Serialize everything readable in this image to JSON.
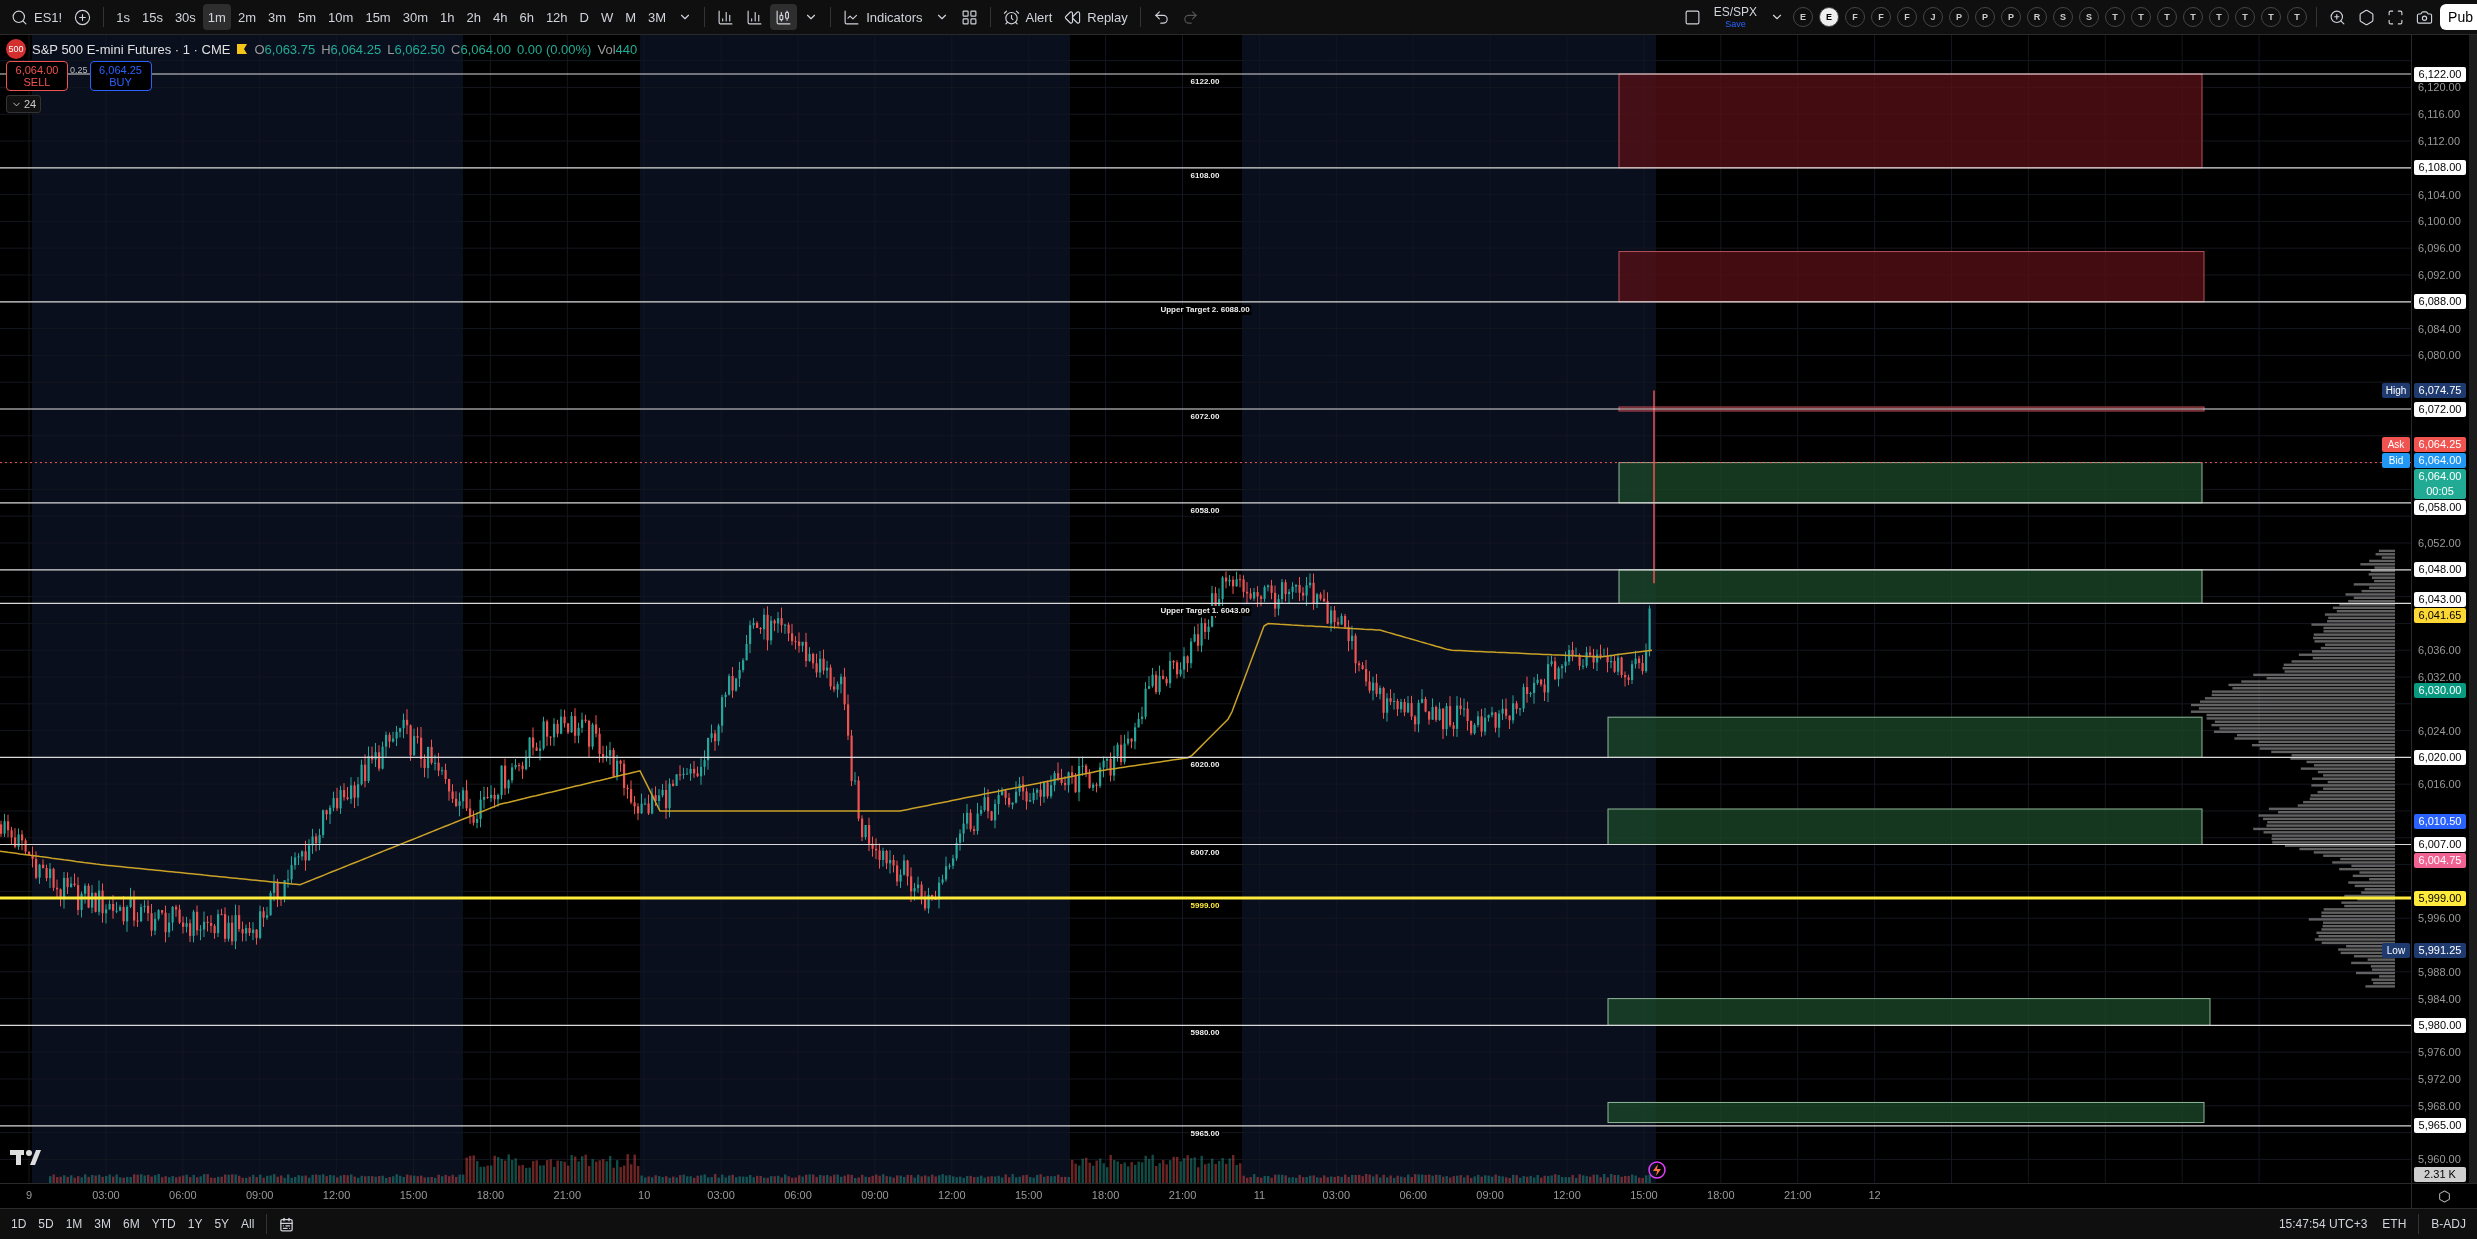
{
  "toolbar": {
    "symbol": "ES1!",
    "intervals": [
      {
        "label": "1s",
        "selected": false
      },
      {
        "label": "15s",
        "selected": false
      },
      {
        "label": "30s",
        "selected": false
      },
      {
        "label": "1m",
        "selected": true
      },
      {
        "label": "2m",
        "selected": false
      },
      {
        "label": "3m",
        "selected": false
      },
      {
        "label": "5m",
        "selected": false
      },
      {
        "label": "10m",
        "selected": false
      },
      {
        "label": "15m",
        "selected": false
      },
      {
        "label": "30m",
        "selected": false
      },
      {
        "label": "1h",
        "selected": false
      },
      {
        "label": "2h",
        "selected": false
      },
      {
        "label": "4h",
        "selected": false
      },
      {
        "label": "6h",
        "selected": false
      },
      {
        "label": "12h",
        "selected": false
      },
      {
        "label": "D",
        "selected": false
      },
      {
        "label": "W",
        "selected": false
      },
      {
        "label": "M",
        "selected": false
      },
      {
        "label": "3M",
        "selected": false
      }
    ],
    "indicators": "Indicators",
    "alert": "Alert",
    "replay": "Replay",
    "undo": {
      "disabled": false
    },
    "redo": {
      "disabled": true
    },
    "layout_name": "ES/SPX",
    "layout_save": "Save",
    "letters": [
      {
        "label": "E",
        "selected": false
      },
      {
        "label": "E",
        "selected": true
      },
      {
        "label": "F",
        "selected": false
      },
      {
        "label": "F",
        "selected": false
      },
      {
        "label": "F",
        "selected": false
      },
      {
        "label": "J",
        "selected": false
      },
      {
        "label": "P",
        "selected": false
      },
      {
        "label": "P",
        "selected": false
      },
      {
        "label": "P",
        "selected": false
      },
      {
        "label": "R",
        "selected": false
      },
      {
        "label": "S",
        "selected": false
      },
      {
        "label": "S",
        "selected": false
      },
      {
        "label": "T",
        "selected": false
      },
      {
        "label": "T",
        "selected": false
      },
      {
        "label": "T",
        "selected": false
      },
      {
        "label": "T",
        "selected": false
      },
      {
        "label": "T",
        "selected": false
      },
      {
        "label": "T",
        "selected": false
      },
      {
        "label": "T",
        "selected": false
      },
      {
        "label": "T",
        "selected": false
      }
    ],
    "publish": "Pub"
  },
  "legend": {
    "badge": "500",
    "title": "S&P 500 E-mini Futures · 1 · CME",
    "ohlc": [
      {
        "key": "O",
        "value": "6,063.75"
      },
      {
        "key": "H",
        "value": "6,064.25"
      },
      {
        "key": "L",
        "value": "6,062.50"
      },
      {
        "key": "C",
        "value": "6,064.00"
      }
    ],
    "change": "0.00 (0.00%)",
    "volume_key": "Vol",
    "volume": "440"
  },
  "trade": {
    "sell_price": "6,064.00",
    "sell_label": "SELL",
    "spread": "0.25",
    "buy_price": "6,064.25",
    "buy_label": "BUY"
  },
  "collapse": {
    "count": "24"
  },
  "levels": [
    {
      "label": "6122.00",
      "axis": "6,122.00",
      "kind": "line"
    },
    {
      "label": "6108.00",
      "axis": "6,108.00",
      "kind": "line"
    },
    {
      "label": "Upper Target 2. 6088.00",
      "axis": "6,088.00",
      "kind": "line"
    },
    {
      "label": "6072.00",
      "axis": "6,072.00",
      "kind": "line"
    },
    {
      "label": "6058.00",
      "axis": "6,058.00",
      "kind": "line"
    },
    {
      "axis": "6,048.00",
      "kind": "line"
    },
    {
      "label": "Upper Target 1. 6043.00",
      "axis": "6,043.00",
      "kind": "line"
    },
    {
      "label": "6020.00",
      "axis": "6,020.00",
      "kind": "line"
    },
    {
      "label": "6007.00",
      "axis": "6,007.00",
      "kind": "line"
    },
    {
      "label": "5999.00",
      "axis": "5,999.00",
      "kind": "highlight"
    },
    {
      "label": "5980.00",
      "axis": "5,980.00",
      "kind": "line"
    },
    {
      "label": "5965.00",
      "axis": "5,965.00",
      "kind": "line"
    }
  ],
  "price_ticks": [
    "6,120.00",
    "6,116.00",
    "6,112.00",
    "6,104.00",
    "6,100.00",
    "6,096.00",
    "6,092.00",
    "6,084.00",
    "6,080.00",
    "6,052.00",
    "6,036.00",
    "6,032.00",
    "6,024.00",
    "6,016.00",
    "5,996.00",
    "5,988.00",
    "5,984.00",
    "5,976.00",
    "5,972.00",
    "5,968.00",
    "5,960.00"
  ],
  "price_markers": [
    {
      "tag": "High",
      "value": "6,074.75",
      "color": "#1e3a6e"
    },
    {
      "tag": "Ask",
      "value": "6,064.25",
      "color": "#f05350"
    },
    {
      "tag": "Bid",
      "value": "6,064.00",
      "color": "#2196f3"
    },
    {
      "value": "6,064.00",
      "countdown": "00:05",
      "color": "#22ab94"
    },
    {
      "value": "6,041.65",
      "color": "#fdd835"
    },
    {
      "value": "6,030.00",
      "color": "#089981"
    },
    {
      "value": "6,010.50",
      "color": "#2962ff"
    },
    {
      "value": "6,004.75",
      "color": "#f06292"
    },
    {
      "tag": "Low",
      "value": "5,991.25",
      "color": "#1e3a6e"
    }
  ],
  "volume_badge": "2.31 K",
  "time_labels": [
    "9",
    "03:00",
    "06:00",
    "09:00",
    "12:00",
    "15:00",
    "18:00",
    "21:00",
    "10",
    "03:00",
    "06:00",
    "09:00",
    "12:00",
    "15:00",
    "18:00",
    "21:00",
    "11",
    "03:00",
    "06:00",
    "09:00",
    "12:00",
    "15:00",
    "18:00",
    "21:00",
    "12"
  ],
  "range_buttons": [
    "1D",
    "5D",
    "1M",
    "3M",
    "6M",
    "YTD",
    "1Y",
    "5Y",
    "All"
  ],
  "status": {
    "clock": "15:47:54 UTC+3",
    "session": "ETH",
    "adjust": "B-ADJ"
  }
}
